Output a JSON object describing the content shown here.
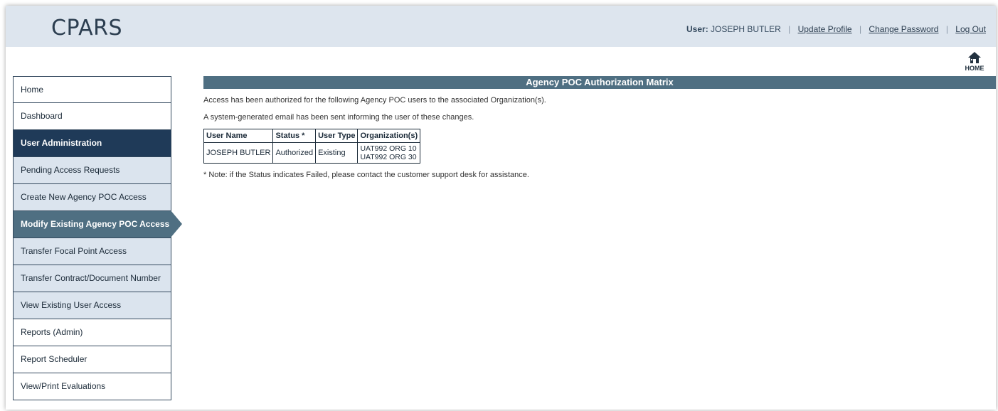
{
  "header": {
    "logo": "CPARS",
    "user_label": "User:",
    "user_name": "JOSEPH BUTLER",
    "links": {
      "update_profile": "Update Profile",
      "change_password": "Change Password",
      "log_out": "Log Out"
    },
    "separator": "|"
  },
  "home_button": {
    "label": "HOME",
    "icon": "home-icon"
  },
  "sidebar": {
    "items": [
      {
        "label": "Home"
      },
      {
        "label": "Dashboard"
      },
      {
        "label": "User Administration"
      },
      {
        "label": "Pending Access Requests"
      },
      {
        "label": "Create New Agency POC Access"
      },
      {
        "label": "Modify Existing Agency POC Access"
      },
      {
        "label": "Transfer Focal Point Access"
      },
      {
        "label": "Transfer Contract/Document Number"
      },
      {
        "label": "View Existing User Access"
      },
      {
        "label": "Reports (Admin)"
      },
      {
        "label": "Report Scheduler"
      },
      {
        "label": "View/Print Evaluations"
      }
    ]
  },
  "main": {
    "title": "Agency POC Authorization Matrix",
    "intro": "Access has been authorized for the following Agency POC users to the associated Organization(s).",
    "email_notice": "A system-generated email has been sent informing the user of these changes.",
    "table": {
      "headers": [
        "User Name",
        "Status *",
        "User Type",
        "Organization(s)"
      ],
      "rows": [
        {
          "user_name": "JOSEPH BUTLER",
          "status": "Authorized",
          "user_type": "Existing",
          "organizations": [
            "UAT992 ORG 10",
            "UAT992 ORG 30"
          ]
        }
      ]
    },
    "note": "* Note: if the Status indicates Failed, please contact the customer support desk for assistance."
  },
  "colors": {
    "header_bg": "#dde5ee",
    "section_bg": "#1f3a58",
    "active_bg": "#4f6f82",
    "sub_bg": "#dbe4ee"
  }
}
